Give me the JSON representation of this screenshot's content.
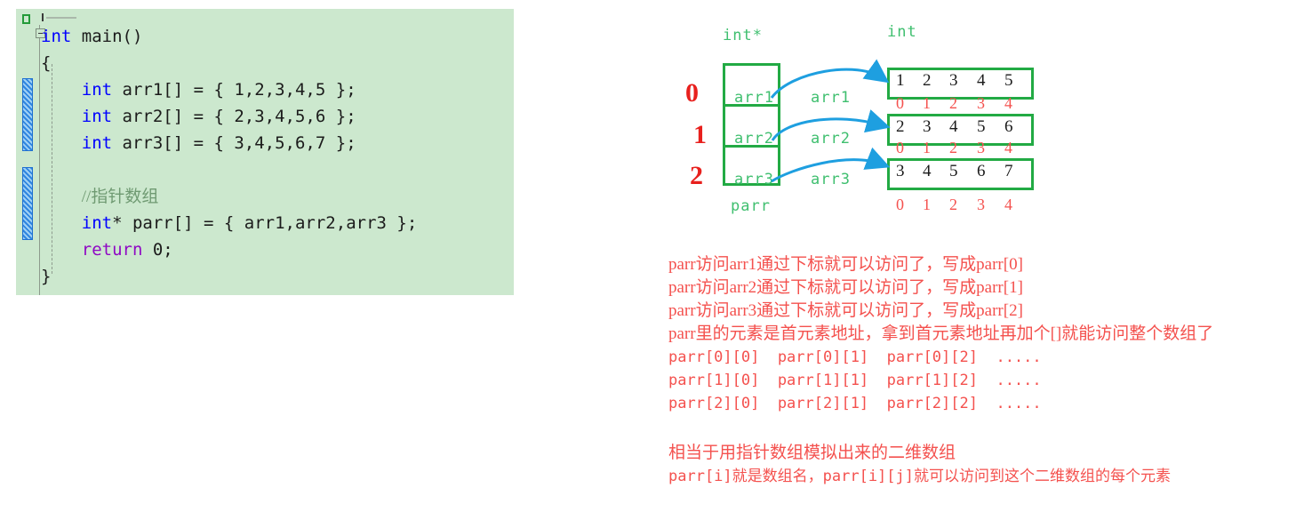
{
  "editor": {
    "background_color": "#cce8ce",
    "gutter": {
      "bookmark_icon": "bookmark-square-icon",
      "collapse_icon": "collapse-minus-icon",
      "change_marker_icon": "change-bar-icon"
    },
    "lines": [
      {
        "id": "l1",
        "tokens": [
          {
            "t": "int",
            "c": "kw"
          },
          {
            "t": " main()",
            "c": "pl"
          }
        ]
      },
      {
        "id": "l2",
        "tokens": [
          {
            "t": "{",
            "c": "pl"
          }
        ]
      },
      {
        "id": "l3",
        "tokens": [
          {
            "t": "    ",
            "c": "pl"
          },
          {
            "t": "int",
            "c": "kw"
          },
          {
            "t": " arr1[] = { 1,2,3,4,5 };",
            "c": "pl"
          }
        ]
      },
      {
        "id": "l4",
        "tokens": [
          {
            "t": "    ",
            "c": "pl"
          },
          {
            "t": "int",
            "c": "kw"
          },
          {
            "t": " arr2[] = { 2,3,4,5,6 };",
            "c": "pl"
          }
        ]
      },
      {
        "id": "l5",
        "tokens": [
          {
            "t": "    ",
            "c": "pl"
          },
          {
            "t": "int",
            "c": "kw"
          },
          {
            "t": " arr3[] = { 3,4,5,6,7 };",
            "c": "pl"
          }
        ]
      },
      {
        "id": "l6",
        "tokens": [
          {
            "t": "",
            "c": "pl"
          }
        ]
      },
      {
        "id": "l7",
        "tokens": [
          {
            "t": "    ",
            "c": "pl"
          },
          {
            "t": "//指针数组",
            "c": "cmt"
          }
        ]
      },
      {
        "id": "l8",
        "tokens": [
          {
            "t": "    ",
            "c": "pl"
          },
          {
            "t": "int",
            "c": "kw"
          },
          {
            "t": "* parr[] = { arr1,arr2,arr3 };",
            "c": "pl"
          }
        ]
      },
      {
        "id": "l9",
        "tokens": [
          {
            "t": "    ",
            "c": "pl"
          },
          {
            "t": "return",
            "c": "ret"
          },
          {
            "t": " 0;",
            "c": "pl"
          }
        ]
      },
      {
        "id": "l10",
        "tokens": [
          {
            "t": "}",
            "c": "pl"
          }
        ]
      }
    ]
  },
  "diagram": {
    "colors": {
      "box_green": "#22aa44",
      "label_green": "#3fbf6f",
      "arrow_blue": "#1e9fe0",
      "index_red": "#f4514e",
      "hand_red": "#e8201d"
    },
    "pointer_array": {
      "type_label": "int*",
      "name_label": "parr",
      "cells": [
        "arr1",
        "arr2",
        "arr3"
      ],
      "hand_indices": [
        "0",
        "1",
        "2"
      ]
    },
    "arrow_labels": [
      "arr1",
      "arr2",
      "arr3"
    ],
    "target_arrays": {
      "type_label": "int",
      "rows": [
        {
          "values": [
            "1",
            "2",
            "3",
            "4",
            "5"
          ],
          "indices": [
            "0",
            "1",
            "2",
            "3",
            "4"
          ]
        },
        {
          "values": [
            "2",
            "3",
            "4",
            "5",
            "6"
          ],
          "indices": [
            "0",
            "1",
            "2",
            "3",
            "4"
          ]
        },
        {
          "values": [
            "3",
            "4",
            "5",
            "6",
            "7"
          ],
          "indices": [
            "0",
            "1",
            "2",
            "3",
            "4"
          ]
        }
      ]
    }
  },
  "notes": {
    "color": "#f4514e",
    "block_a": [
      "parr访问arr1通过下标就可以访问了，写成parr[0]",
      "parr访问arr2通过下标就可以访问了，写成parr[1]",
      "parr访问arr3通过下标就可以访问了，写成parr[2]",
      "parr里的元素是首元素地址，拿到首元素地址再加个[]就能访问整个数组了",
      "parr[0][0]  parr[0][1]  parr[0][2]  .....",
      "parr[1][0]  parr[1][1]  parr[1][2]  .....",
      "parr[2][0]  parr[2][1]  parr[2][2]  ....."
    ],
    "block_b": [
      "相当于用指针数组模拟出来的二维数组",
      "parr[i]就是数组名，parr[i][j]就可以访问到这个二维数组的每个元素"
    ]
  }
}
